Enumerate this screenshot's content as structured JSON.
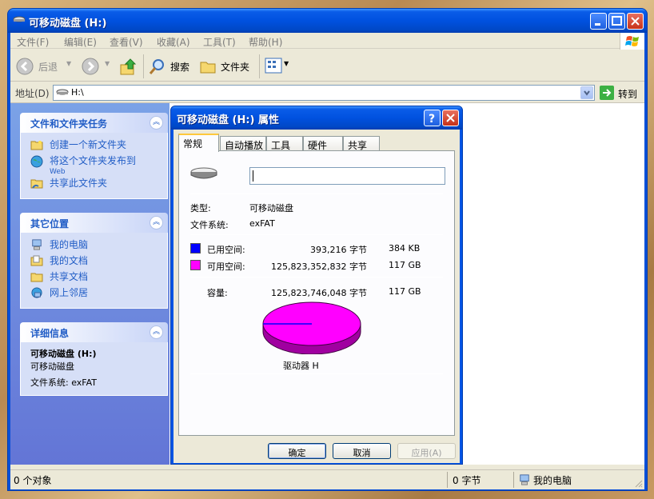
{
  "window": {
    "title": "可移动磁盘 (H:)"
  },
  "menu": [
    "文件(F)",
    "编辑(E)",
    "查看(V)",
    "收藏(A)",
    "工具(T)",
    "帮助(H)"
  ],
  "toolbar": {
    "back": "后退",
    "search": "搜索",
    "folders": "文件夹"
  },
  "address": {
    "label": "地址(D)",
    "value": "H:\\",
    "go": "转到"
  },
  "tasks_panel": {
    "title": "文件和文件夹任务",
    "items": [
      "创建一个新文件夹",
      "将这个文件夹发布到",
      "Web",
      "共享此文件夹"
    ]
  },
  "places_panel": {
    "title": "其它位置",
    "items": [
      "我的电脑",
      "我的文档",
      "共享文档",
      "网上邻居"
    ]
  },
  "details_panel": {
    "title": "详细信息",
    "name": "可移动磁盘 (H:)",
    "type": "可移动磁盘",
    "fs": "文件系统: exFAT"
  },
  "status": {
    "objects": "0 个对象",
    "bytes": "0 字节",
    "location": "我的电脑"
  },
  "dialog": {
    "title": "可移动磁盘 (H:) 属性",
    "tabs": [
      "常规",
      "自动播放",
      "工具",
      "硬件",
      "共享"
    ],
    "name_value": "",
    "type_label": "类型:",
    "type_value": "可移动磁盘",
    "fs_label": "文件系统:",
    "fs_value": "exFAT",
    "used_label": "已用空间:",
    "used_bytes": "393,216 字节",
    "used_size": "384 KB",
    "free_label": "可用空间:",
    "free_bytes": "125,823,352,832 字节",
    "free_size": "117 GB",
    "capacity_label": "容量:",
    "capacity_bytes": "125,823,746,048 字节",
    "capacity_size": "117 GB",
    "drive_label": "驱动器 H",
    "used_fraction": 3.1e-06,
    "buttons": {
      "ok": "确定",
      "cancel": "取消",
      "apply": "应用(A)"
    }
  },
  "colors": {
    "used": "#0000ff",
    "free": "#ff00ff",
    "xp_blue": "#0054e3"
  }
}
